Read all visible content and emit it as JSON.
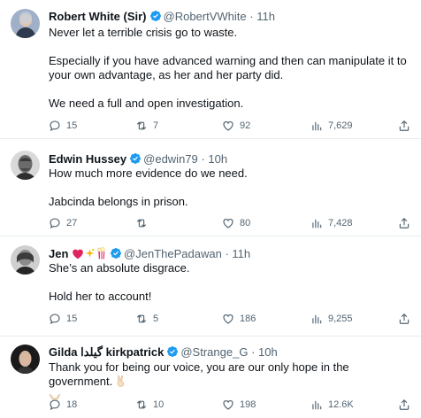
{
  "tweets": [
    {
      "name": "Robert White (Sir)",
      "handle": "@RobertVWhite",
      "time": "11h",
      "body": [
        "Never let a terrible crisis go to waste.",
        "Especially if you have advanced warning and then can manipulate it to your own advantage, as her and her party did.",
        "We need a full and open investigation."
      ],
      "replies": "15",
      "retweets": "7",
      "likes": "92",
      "views": "7,629"
    },
    {
      "name": "Edwin Hussey",
      "handle": "@edwin79",
      "time": "10h",
      "body": [
        "How much more evidence do we need.",
        "Jabcinda belongs in prison."
      ],
      "replies": "27",
      "retweets": "",
      "likes": "80",
      "views": "7,428"
    },
    {
      "name": "Jen",
      "handle": "@JenThePadawan",
      "time": "11h",
      "body": [
        "She’s an absolute disgrace.",
        "Hold her to account!"
      ],
      "replies": "15",
      "retweets": "5",
      "likes": "186",
      "views": "9,255"
    },
    {
      "name": "Gilda گیلدا kirkpatrick",
      "handle": "@Strange_G",
      "time": "10h",
      "body": [
        "Thank you for being our voice, you are our only hope in the government."
      ],
      "replies": "18",
      "retweets": "10",
      "likes": "198",
      "views": "12.6K"
    }
  ],
  "separator": "·",
  "colors": {
    "verified": "#1d9bf0",
    "text": "#0f1419",
    "muted": "#536471",
    "divider": "#e6ecf0"
  },
  "icons": [
    "verified-badge-icon",
    "reply-icon",
    "retweet-icon",
    "like-icon",
    "views-icon",
    "share-icon"
  ]
}
